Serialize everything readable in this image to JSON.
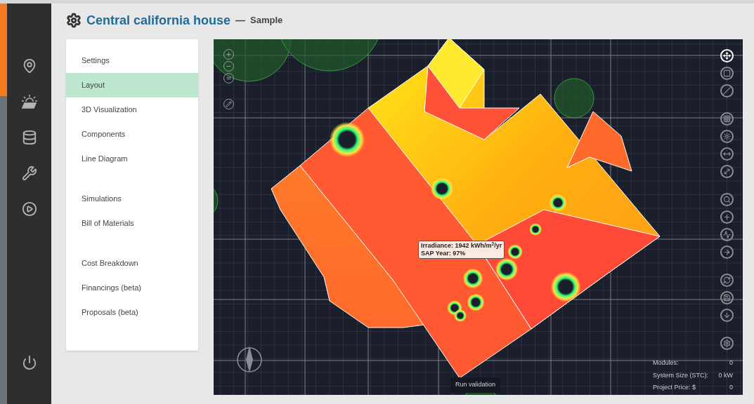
{
  "header": {
    "title": "Central california house",
    "separator": "—",
    "subtitle": "Sample"
  },
  "sidebar": {
    "items": [
      {
        "kind": "location",
        "selected": false
      },
      {
        "kind": "solar",
        "selected": false
      },
      {
        "kind": "database",
        "selected": false
      },
      {
        "kind": "wrench",
        "selected": false
      },
      {
        "kind": "play",
        "selected": false
      }
    ],
    "bottom": {
      "kind": "power"
    }
  },
  "menu": {
    "groups": [
      [
        {
          "label": "Settings",
          "selected": false
        },
        {
          "label": "Layout",
          "selected": true
        },
        {
          "label": "3D Visualization",
          "selected": false
        },
        {
          "label": "Components",
          "selected": false
        },
        {
          "label": "Line Diagram",
          "selected": false
        }
      ],
      [
        {
          "label": "Simulations",
          "selected": false
        },
        {
          "label": "Bill of Materials",
          "selected": false
        }
      ],
      [
        {
          "label": "Cost Breakdown",
          "selected": false
        },
        {
          "label": "Financings (beta)",
          "selected": false
        },
        {
          "label": "Proposals (beta)",
          "selected": false
        }
      ]
    ]
  },
  "canvas": {
    "left_tools": [
      {
        "kind": "zoom-in"
      },
      {
        "kind": "zoom-out"
      },
      {
        "kind": "equal"
      },
      {
        "kind": "draw"
      }
    ],
    "right_tools": [
      [
        {
          "kind": "move",
          "selected": true
        },
        {
          "kind": "square",
          "selected": false
        },
        {
          "kind": "hatch",
          "selected": false
        }
      ],
      [
        {
          "kind": "grid",
          "selected": false
        },
        {
          "kind": "sun",
          "selected": false
        },
        {
          "kind": "measure",
          "selected": false
        },
        {
          "kind": "diagonal",
          "selected": false
        }
      ],
      [
        {
          "kind": "search",
          "selected": false
        },
        {
          "kind": "add",
          "selected": false
        },
        {
          "kind": "wave",
          "selected": false
        },
        {
          "kind": "connect",
          "selected": false
        }
      ],
      [
        {
          "kind": "refresh",
          "selected": false
        },
        {
          "kind": "save",
          "selected": false
        },
        {
          "kind": "download",
          "selected": false
        }
      ],
      [
        {
          "kind": "settings",
          "selected": false
        }
      ]
    ],
    "tooltip": [
      "Irradiance: 1942 kWh/m$^{2}$/yr",
      "SAP Year: 97%"
    ],
    "validation_button": "Run validation",
    "stats": [
      {
        "label": "Modules:",
        "value": "0"
      },
      {
        "label": "System Size (STC):",
        "value": "0 kW"
      },
      {
        "label": "Project Price: $",
        "value": "0"
      }
    ]
  }
}
